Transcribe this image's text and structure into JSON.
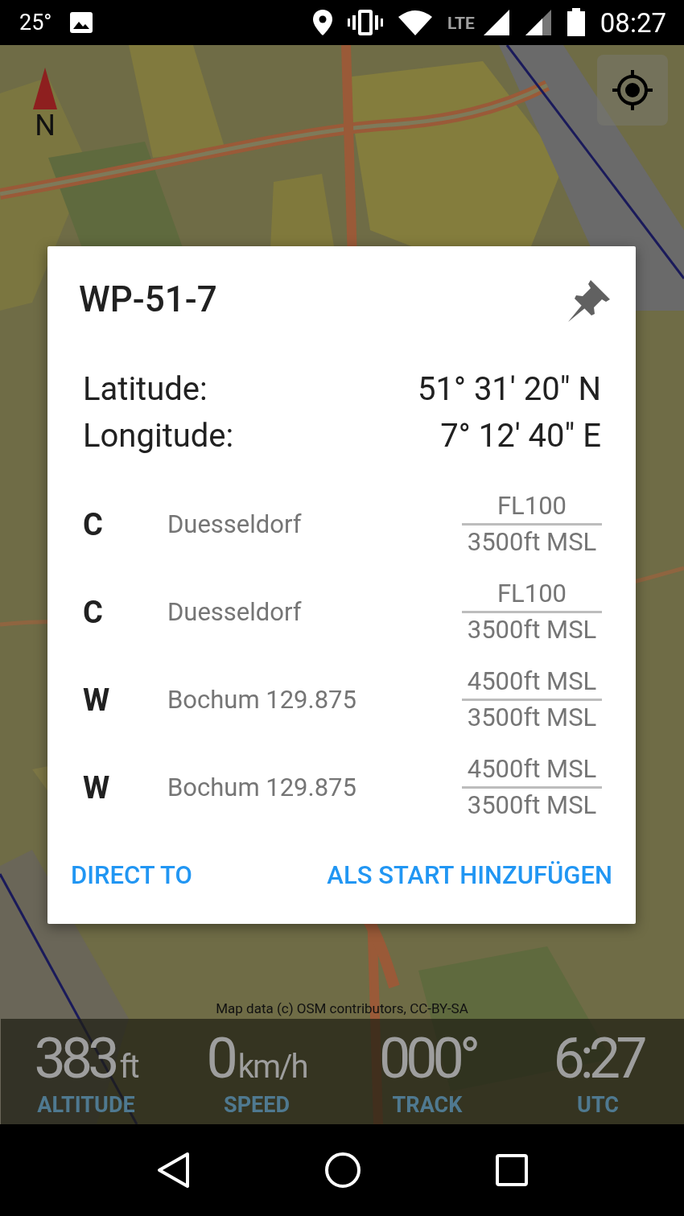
{
  "status_bar": {
    "temperature": "25°",
    "network": "LTE",
    "time": "08:27"
  },
  "map": {
    "compass_label": "N",
    "attribution": "Map data (c) OSM contributors, CC-BY-SA"
  },
  "dialog": {
    "title": "WP-51-7",
    "coordinates": [
      {
        "label": "Latitude:",
        "value": "51° 31' 20\" N"
      },
      {
        "label": "Longitude:",
        "value": "7° 12' 40\" E"
      }
    ],
    "airspaces": [
      {
        "class": "C",
        "name": "Duesseldorf",
        "upper": "FL100",
        "lower": "3500ft MSL"
      },
      {
        "class": "C",
        "name": "Duesseldorf",
        "upper": "FL100",
        "lower": "3500ft MSL"
      },
      {
        "class": "W",
        "name": "Bochum 129.875",
        "upper": "4500ft MSL",
        "lower": "3500ft MSL"
      },
      {
        "class": "W",
        "name": "Bochum 129.875",
        "upper": "4500ft MSL",
        "lower": "3500ft MSL"
      }
    ],
    "buttons": [
      "DIRECT TO",
      "ALS START HINZUFÜGEN"
    ]
  },
  "instruments": [
    {
      "value": "383",
      "unit": "ft",
      "label": "ALTITUDE"
    },
    {
      "value": "0",
      "unit": "km/h",
      "label": "SPEED"
    },
    {
      "value": "000°",
      "label": "TRACK"
    },
    {
      "value": "6:27",
      "label": "UTC"
    }
  ]
}
